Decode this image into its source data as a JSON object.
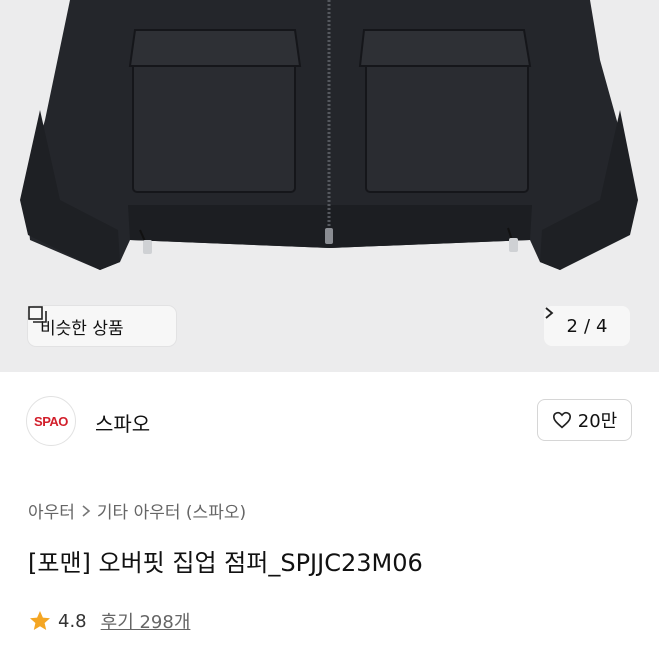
{
  "gallery": {
    "similar_label": "비슷한 상품",
    "page_current": "2",
    "page_sep": "/",
    "page_total": "4"
  },
  "brand": {
    "logo_text": "SPAO",
    "name": "스파오",
    "likes": "20만"
  },
  "breadcrumb": {
    "items": [
      "아우터",
      "기타 아우터 (스파오)"
    ]
  },
  "product": {
    "title": "[포맨] 오버핏 집업 점퍼_SPJJC23M06"
  },
  "rating": {
    "score": "4.8",
    "reviews_label": "후기 298개"
  },
  "colors": {
    "accent_star": "#f4a623",
    "logo_red": "#d21f2b"
  },
  "icons": {
    "similar": "stacked-squares-icon",
    "next": "chevron-right-icon",
    "like": "heart-icon",
    "star": "star-icon"
  }
}
